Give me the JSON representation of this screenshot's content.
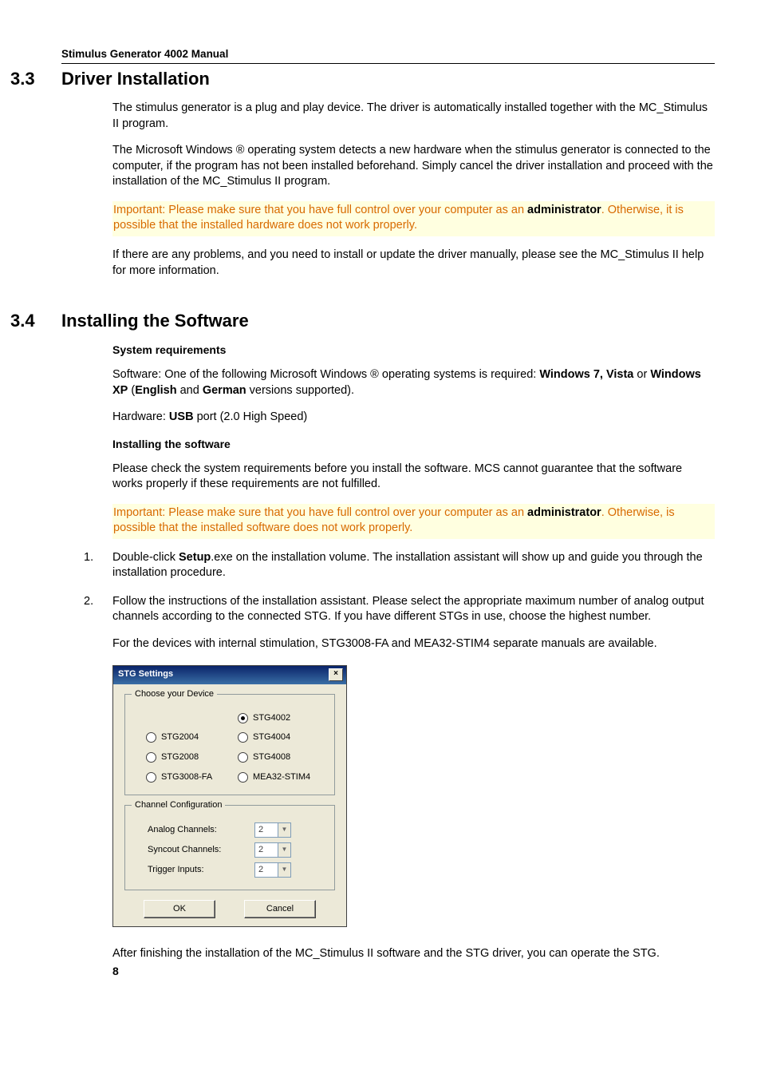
{
  "running_header": "Stimulus Generator 4002 Manual",
  "sec33": {
    "num": "3.3",
    "title": "Driver Installation",
    "p1": "The stimulus generator is a plug and play device. The driver is automatically installed together with the MC_Stimulus II program.",
    "p2": "The Microsoft Windows ® operating system detects a new hardware when the stimulus generator is connected to the computer, if the program has not been installed beforehand. Simply cancel the driver installation and proceed with the installation of  the MC_Stimulus II program.",
    "note_a": "Important: Please make sure that you have full control over your computer as an ",
    "note_bold": "administrator",
    "note_b": ". Otherwise, it is possible that the installed hardware does not work properly.",
    "p3": "If there are any problems, and you need to install or update the driver manually, please see the MC_Stimulus II help for more information."
  },
  "sec34": {
    "num": "3.4",
    "title": "Installing the Software",
    "h_req": "System requirements",
    "req_sw_a": "Software: One of the following Microsoft Windows ® operating systems is required: ",
    "req_sw_b1": "Windows 7, Vista",
    "req_sw_mid": " or ",
    "req_sw_b2": "Windows XP",
    "req_sw_par_open": " (",
    "req_sw_b3": "English",
    "req_sw_and": " and ",
    "req_sw_b4": "German",
    "req_sw_tail": " versions supported).",
    "req_hw_a": "Hardware: ",
    "req_hw_bold": "USB",
    "req_hw_b": "  port (2.0 High Speed)",
    "h_inst": "Installing the software",
    "p_check": "Please check the system requirements before you install the software. MCS cannot guarantee that the software works properly if these requirements are not fulfilled.",
    "note2_a": "Important: Please make sure that you have full control over your computer as an ",
    "note2_bold": "administrator",
    "note2_b": ". Otherwise, is possible that the installed software does not work properly.",
    "step1_a": "Double-click ",
    "step1_bold": "Setup",
    "step1_b": ".exe on the installation volume. The installation assistant will show up and guide you through the installation procedure.",
    "step2": "Follow the instructions of the installation assistant. Please select the appropriate maximum number of analog output channels according to the connected STG. If you have different STGs in use, choose the highest number.",
    "step2b": "For the devices with internal stimulation, STG3008-FA and MEA32-STIM4 separate manuals are available.",
    "after": "After finishing the installation of the MC_Stimulus II software and the STG driver, you can operate the STG."
  },
  "dialog": {
    "title": "STG Settings",
    "close": "×",
    "group1": "Choose your Device",
    "devices": {
      "stg4002": "STG4002",
      "stg2004": "STG2004",
      "stg4004": "STG4004",
      "stg2008": "STG2008",
      "stg4008": "STG4008",
      "stg3008fa": "STG3008-FA",
      "mea32": "MEA32-STIM4"
    },
    "group2": "Channel Configuration",
    "rows": {
      "analog_label": "Analog Channels:",
      "analog_val": "2",
      "syncout_label": "Syncout Channels:",
      "syncout_val": "2",
      "trigger_label": "Trigger Inputs:",
      "trigger_val": "2"
    },
    "ok": "OK",
    "cancel": "Cancel"
  },
  "icons": {
    "arrow_down": "▼"
  },
  "page_number": "8",
  "step_numbers": {
    "s1": "1.",
    "s2": "2."
  }
}
